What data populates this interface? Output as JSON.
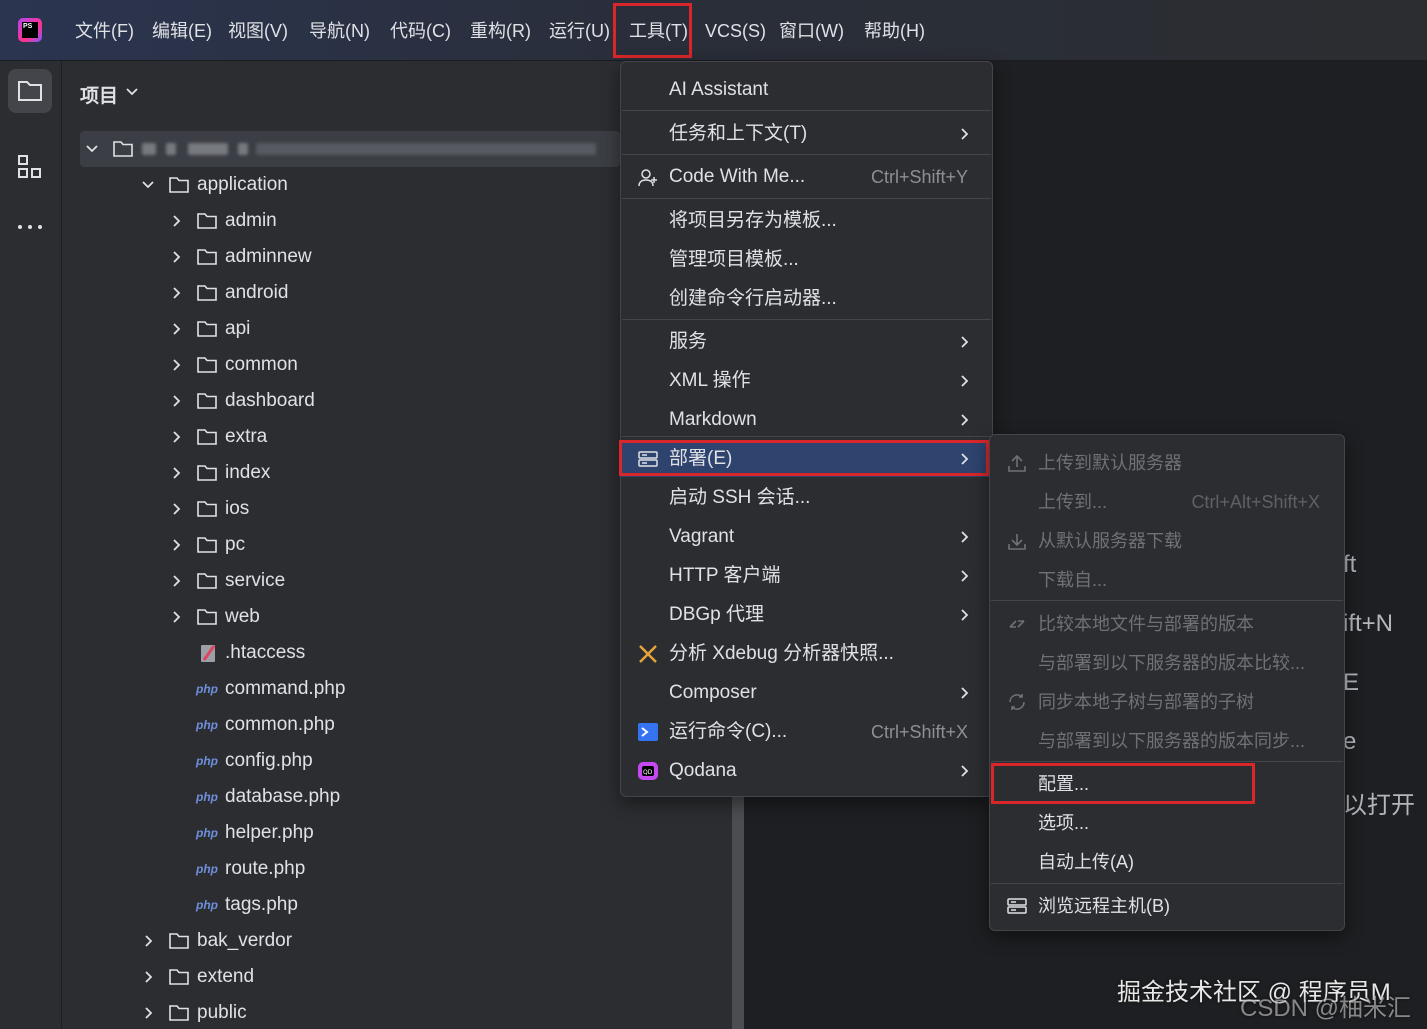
{
  "app": {
    "logo_text": "PS"
  },
  "menubar": {
    "items": [
      "文件(F)",
      "编辑(E)",
      "视图(V)",
      "导航(N)",
      "代码(C)",
      "重构(R)",
      "运行(U)",
      "工具(T)",
      "VCS(S)",
      "窗口(W)",
      "帮助(H)"
    ],
    "active_index": 7
  },
  "project_panel": {
    "title": "项目",
    "tree": [
      {
        "label": "application",
        "type": "folder",
        "expanded": true
      },
      {
        "label": "admin",
        "type": "folder"
      },
      {
        "label": "adminnew",
        "type": "folder"
      },
      {
        "label": "android",
        "type": "folder"
      },
      {
        "label": "api",
        "type": "folder"
      },
      {
        "label": "common",
        "type": "folder"
      },
      {
        "label": "dashboard",
        "type": "folder"
      },
      {
        "label": "extra",
        "type": "folder"
      },
      {
        "label": "index",
        "type": "folder"
      },
      {
        "label": "ios",
        "type": "folder"
      },
      {
        "label": "pc",
        "type": "folder"
      },
      {
        "label": "service",
        "type": "folder"
      },
      {
        "label": "web",
        "type": "folder"
      },
      {
        "label": ".htaccess",
        "type": "htaccess"
      },
      {
        "label": "command.php",
        "type": "php"
      },
      {
        "label": "common.php",
        "type": "php"
      },
      {
        "label": "config.php",
        "type": "php"
      },
      {
        "label": "database.php",
        "type": "php"
      },
      {
        "label": "helper.php",
        "type": "php"
      },
      {
        "label": "route.php",
        "type": "php"
      },
      {
        "label": "tags.php",
        "type": "php"
      },
      {
        "label": "bak_verdor",
        "type": "folder"
      },
      {
        "label": "extend",
        "type": "folder"
      },
      {
        "label": "public",
        "type": "folder"
      }
    ],
    "php_badge": "php"
  },
  "tools_menu": {
    "items": [
      {
        "label": "AI Assistant"
      },
      {
        "label": "任务和上下文(T)",
        "submenu": true
      },
      {
        "label": "Code With Me...",
        "shortcut": "Ctrl+Shift+Y",
        "icon": "user-plus-icon"
      },
      {
        "label": "将项目另存为模板..."
      },
      {
        "label": "管理项目模板..."
      },
      {
        "label": "创建命令行启动器..."
      },
      {
        "label": "服务",
        "submenu": true
      },
      {
        "label": "XML 操作",
        "submenu": true
      },
      {
        "label": "Markdown",
        "submenu": true
      },
      {
        "label": "部署(E)",
        "submenu": true,
        "icon": "server-icon",
        "selected": true
      },
      {
        "label": "启动 SSH 会话..."
      },
      {
        "label": "Vagrant",
        "submenu": true
      },
      {
        "label": "HTTP 客户端",
        "submenu": true
      },
      {
        "label": "DBGp 代理",
        "submenu": true
      },
      {
        "label": "分析 Xdebug 分析器快照...",
        "icon": "xdebug-icon"
      },
      {
        "label": "Composer",
        "submenu": true
      },
      {
        "label": "运行命令(C)...",
        "shortcut": "Ctrl+Shift+X",
        "icon": "terminal-icon"
      },
      {
        "label": "Qodana",
        "submenu": true,
        "icon": "qodana-icon"
      }
    ]
  },
  "deploy_submenu": {
    "items": [
      {
        "label": "上传到默认服务器",
        "enabled": false,
        "icon": "upload-icon"
      },
      {
        "label": "上传到...",
        "shortcut": "Ctrl+Alt+Shift+X",
        "enabled": false
      },
      {
        "label": "从默认服务器下载",
        "enabled": false,
        "icon": "download-icon"
      },
      {
        "label": "下载自...",
        "enabled": false
      },
      {
        "label": "比较本地文件与部署的版本",
        "enabled": false,
        "icon": "compare-icon"
      },
      {
        "label": "与部署到以下服务器的版本比较...",
        "enabled": false
      },
      {
        "label": "同步本地子树与部署的子树",
        "enabled": false,
        "icon": "sync-icon"
      },
      {
        "label": "与部署到以下服务器的版本同步...",
        "enabled": false
      },
      {
        "label": "配置...",
        "enabled": true
      },
      {
        "label": "选项...",
        "enabled": true
      },
      {
        "label": "自动上传(A)",
        "enabled": true
      },
      {
        "label": "浏览远程主机(B)",
        "enabled": true,
        "icon": "server-icon"
      }
    ]
  },
  "editor_ghost": [
    "ft",
    "ift+N",
    "E",
    "e",
    "以打开"
  ],
  "watermarks": [
    "掘金技术社区 @ 程序员M",
    "CSDN @柚米汇"
  ],
  "colors": {
    "highlight_border": "#d9262a",
    "selection": "#2e436e",
    "accent_php": "#6f8fdc"
  }
}
